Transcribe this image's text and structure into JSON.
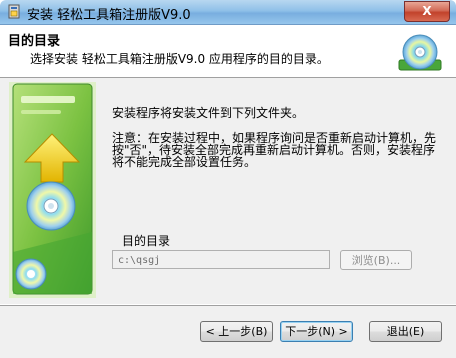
{
  "window": {
    "title": "安装 轻松工具箱注册版V9.0",
    "close_label": "X"
  },
  "header": {
    "title": "目的目录",
    "subtitle": "选择安装 轻松工具箱注册版V9.0 应用程序的目的目录。",
    "icon": "cd-disc-icon"
  },
  "content": {
    "intro": "安装程序将安装文件到下列文件夹。",
    "note": "注意：在安装过程中，如果程序询问是否重新启动计算机，先按\"否\"，待安装全部完成再重新启动计算机。否则，安装程序将不能完成全部设置任务。"
  },
  "dest": {
    "label": "目的目录",
    "path": "c:\\qsgj",
    "browse_label": "浏览(B)..."
  },
  "buttons": {
    "back": "< 上一步(B)",
    "next": "下一步(N) >",
    "exit": "退出(E)"
  },
  "colors": {
    "sidebar_green": "#7cc242",
    "arrow_yellow": "#f3d21a",
    "title_gradient": "#8fc0e8",
    "close_red": "#c2422b"
  }
}
